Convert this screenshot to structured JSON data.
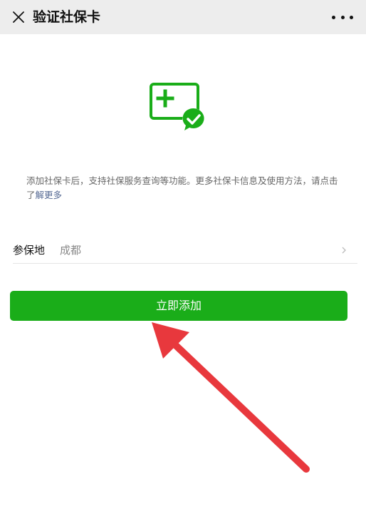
{
  "header": {
    "title": "验证社保卡",
    "close_icon": "close-icon",
    "more_icon": "more-icon"
  },
  "intro": {
    "text": "添加社保卡后，支持社保服务查询等功能。更多社保卡信息及使用方法，请点击了",
    "link": "解更多"
  },
  "form": {
    "insured_place_label": "参保地",
    "insured_place_value": "成都"
  },
  "actions": {
    "add_label": "立即添加"
  },
  "colors": {
    "primary_green": "#1aad19",
    "link_blue": "#576b95",
    "arrow_red": "#e8383d",
    "header_bg": "#ededed"
  }
}
